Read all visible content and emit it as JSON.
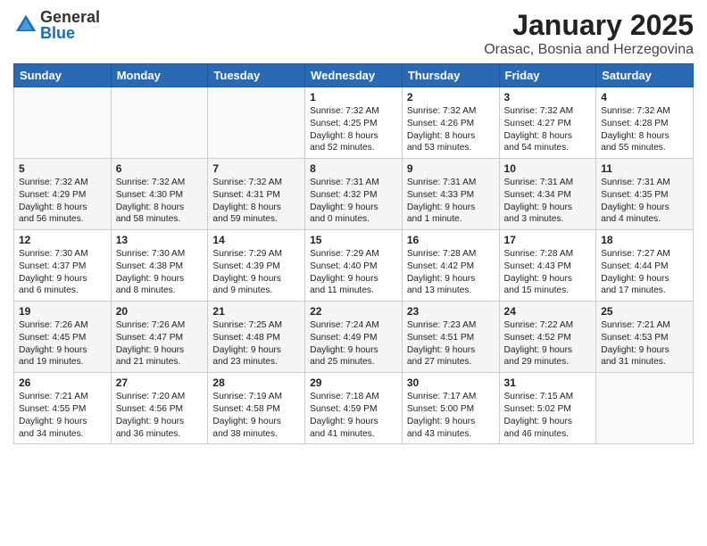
{
  "logo": {
    "general": "General",
    "blue": "Blue"
  },
  "title": "January 2025",
  "subtitle": "Orasac, Bosnia and Herzegovina",
  "days_of_week": [
    "Sunday",
    "Monday",
    "Tuesday",
    "Wednesday",
    "Thursday",
    "Friday",
    "Saturday"
  ],
  "weeks": [
    [
      {
        "day": "",
        "info": ""
      },
      {
        "day": "",
        "info": ""
      },
      {
        "day": "",
        "info": ""
      },
      {
        "day": "1",
        "info": "Sunrise: 7:32 AM\nSunset: 4:25 PM\nDaylight: 8 hours\nand 52 minutes."
      },
      {
        "day": "2",
        "info": "Sunrise: 7:32 AM\nSunset: 4:26 PM\nDaylight: 8 hours\nand 53 minutes."
      },
      {
        "day": "3",
        "info": "Sunrise: 7:32 AM\nSunset: 4:27 PM\nDaylight: 8 hours\nand 54 minutes."
      },
      {
        "day": "4",
        "info": "Sunrise: 7:32 AM\nSunset: 4:28 PM\nDaylight: 8 hours\nand 55 minutes."
      }
    ],
    [
      {
        "day": "5",
        "info": "Sunrise: 7:32 AM\nSunset: 4:29 PM\nDaylight: 8 hours\nand 56 minutes."
      },
      {
        "day": "6",
        "info": "Sunrise: 7:32 AM\nSunset: 4:30 PM\nDaylight: 8 hours\nand 58 minutes."
      },
      {
        "day": "7",
        "info": "Sunrise: 7:32 AM\nSunset: 4:31 PM\nDaylight: 8 hours\nand 59 minutes."
      },
      {
        "day": "8",
        "info": "Sunrise: 7:31 AM\nSunset: 4:32 PM\nDaylight: 9 hours\nand 0 minutes."
      },
      {
        "day": "9",
        "info": "Sunrise: 7:31 AM\nSunset: 4:33 PM\nDaylight: 9 hours\nand 1 minute."
      },
      {
        "day": "10",
        "info": "Sunrise: 7:31 AM\nSunset: 4:34 PM\nDaylight: 9 hours\nand 3 minutes."
      },
      {
        "day": "11",
        "info": "Sunrise: 7:31 AM\nSunset: 4:35 PM\nDaylight: 9 hours\nand 4 minutes."
      }
    ],
    [
      {
        "day": "12",
        "info": "Sunrise: 7:30 AM\nSunset: 4:37 PM\nDaylight: 9 hours\nand 6 minutes."
      },
      {
        "day": "13",
        "info": "Sunrise: 7:30 AM\nSunset: 4:38 PM\nDaylight: 9 hours\nand 8 minutes."
      },
      {
        "day": "14",
        "info": "Sunrise: 7:29 AM\nSunset: 4:39 PM\nDaylight: 9 hours\nand 9 minutes."
      },
      {
        "day": "15",
        "info": "Sunrise: 7:29 AM\nSunset: 4:40 PM\nDaylight: 9 hours\nand 11 minutes."
      },
      {
        "day": "16",
        "info": "Sunrise: 7:28 AM\nSunset: 4:42 PM\nDaylight: 9 hours\nand 13 minutes."
      },
      {
        "day": "17",
        "info": "Sunrise: 7:28 AM\nSunset: 4:43 PM\nDaylight: 9 hours\nand 15 minutes."
      },
      {
        "day": "18",
        "info": "Sunrise: 7:27 AM\nSunset: 4:44 PM\nDaylight: 9 hours\nand 17 minutes."
      }
    ],
    [
      {
        "day": "19",
        "info": "Sunrise: 7:26 AM\nSunset: 4:45 PM\nDaylight: 9 hours\nand 19 minutes."
      },
      {
        "day": "20",
        "info": "Sunrise: 7:26 AM\nSunset: 4:47 PM\nDaylight: 9 hours\nand 21 minutes."
      },
      {
        "day": "21",
        "info": "Sunrise: 7:25 AM\nSunset: 4:48 PM\nDaylight: 9 hours\nand 23 minutes."
      },
      {
        "day": "22",
        "info": "Sunrise: 7:24 AM\nSunset: 4:49 PM\nDaylight: 9 hours\nand 25 minutes."
      },
      {
        "day": "23",
        "info": "Sunrise: 7:23 AM\nSunset: 4:51 PM\nDaylight: 9 hours\nand 27 minutes."
      },
      {
        "day": "24",
        "info": "Sunrise: 7:22 AM\nSunset: 4:52 PM\nDaylight: 9 hours\nand 29 minutes."
      },
      {
        "day": "25",
        "info": "Sunrise: 7:21 AM\nSunset: 4:53 PM\nDaylight: 9 hours\nand 31 minutes."
      }
    ],
    [
      {
        "day": "26",
        "info": "Sunrise: 7:21 AM\nSunset: 4:55 PM\nDaylight: 9 hours\nand 34 minutes."
      },
      {
        "day": "27",
        "info": "Sunrise: 7:20 AM\nSunset: 4:56 PM\nDaylight: 9 hours\nand 36 minutes."
      },
      {
        "day": "28",
        "info": "Sunrise: 7:19 AM\nSunset: 4:58 PM\nDaylight: 9 hours\nand 38 minutes."
      },
      {
        "day": "29",
        "info": "Sunrise: 7:18 AM\nSunset: 4:59 PM\nDaylight: 9 hours\nand 41 minutes."
      },
      {
        "day": "30",
        "info": "Sunrise: 7:17 AM\nSunset: 5:00 PM\nDaylight: 9 hours\nand 43 minutes."
      },
      {
        "day": "31",
        "info": "Sunrise: 7:15 AM\nSunset: 5:02 PM\nDaylight: 9 hours\nand 46 minutes."
      },
      {
        "day": "",
        "info": ""
      }
    ]
  ]
}
